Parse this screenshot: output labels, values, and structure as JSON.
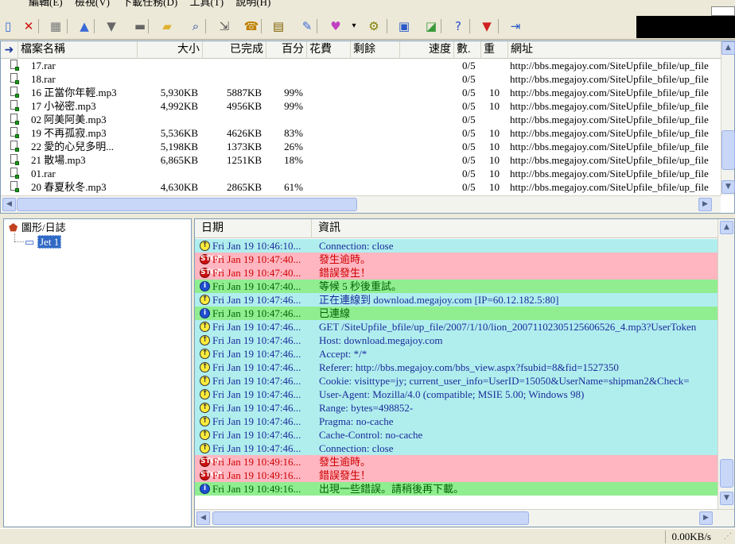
{
  "menu": [
    "編輯(E)",
    "檢視(V)",
    "下載任務(D)",
    "工具(T)",
    "說明(H)"
  ],
  "toolbar": {
    "icons": [
      {
        "name": "new-icon",
        "glyph": "▯",
        "color": "#3a6ad8"
      },
      {
        "name": "delete-icon",
        "glyph": "✕",
        "color": "#d01010"
      },
      {
        "name": "properties-icon",
        "glyph": "▦",
        "color": "#777777"
      },
      {
        "name": "move-up-icon",
        "glyph": "▲",
        "color": "#3a6ad8"
      },
      {
        "name": "move-down-icon",
        "glyph": "▼",
        "color": "#666666"
      },
      {
        "name": "stop-icon",
        "glyph": "▬",
        "color": "#666666"
      },
      {
        "name": "open-folder-icon",
        "glyph": "▰",
        "color": "#e0b030"
      },
      {
        "name": "find-icon",
        "glyph": "⌕",
        "color": "#1a3a9a"
      },
      {
        "name": "find-next-icon",
        "glyph": "⇲",
        "color": "#555555"
      },
      {
        "name": "dial-icon",
        "glyph": "☎",
        "color": "#c08000"
      },
      {
        "name": "schedule-icon",
        "glyph": "▤",
        "color": "#806000"
      },
      {
        "name": "edit-icon",
        "glyph": "✎",
        "color": "#3a6ad8"
      },
      {
        "name": "speed-icon",
        "glyph": "♥",
        "color": "#c040c0"
      },
      {
        "name": "dropdown-icon",
        "glyph": "▾",
        "color": "#000000"
      },
      {
        "name": "options-icon",
        "glyph": "⚙",
        "color": "#808000"
      },
      {
        "name": "site-manager-icon",
        "glyph": "▣",
        "color": "#2a5ac8"
      },
      {
        "name": "batch-icon",
        "glyph": "◪",
        "color": "#3a9a3a"
      },
      {
        "name": "help-icon",
        "glyph": "?",
        "color": "#2a4ac8"
      },
      {
        "name": "skin-icon",
        "glyph": "▼",
        "color": "#d02020"
      },
      {
        "name": "exit-icon",
        "glyph": "⇥",
        "color": "#2a5ac8"
      }
    ]
  },
  "filelist": {
    "columns": [
      "檔案名稱",
      "大小",
      "已完成",
      "百分",
      "花費",
      "剩餘",
      "速度",
      "數.",
      "重",
      "網址"
    ],
    "rows": [
      {
        "name": "17.rar",
        "size": "",
        "done": "",
        "pct": "",
        "cost": "",
        "left": "",
        "speed": "",
        "count": "0/5",
        "retry": "",
        "url": "http://bbs.megajoy.com/SiteUpfile_bfile/up_file"
      },
      {
        "name": "18.rar",
        "size": "",
        "done": "",
        "pct": "",
        "cost": "",
        "left": "",
        "speed": "",
        "count": "0/5",
        "retry": "",
        "url": "http://bbs.megajoy.com/SiteUpfile_bfile/up_file"
      },
      {
        "name": "16 正當你年輕.mp3",
        "size": "5,930KB",
        "done": "5887KB",
        "pct": "99%",
        "cost": "",
        "left": "",
        "speed": "",
        "count": "0/5",
        "retry": "10",
        "url": "http://bbs.megajoy.com/SiteUpfile_bfile/up_file"
      },
      {
        "name": "17 小祕密.mp3",
        "size": "4,992KB",
        "done": "4956KB",
        "pct": "99%",
        "cost": "",
        "left": "",
        "speed": "",
        "count": "0/5",
        "retry": "10",
        "url": "http://bbs.megajoy.com/SiteUpfile_bfile/up_file"
      },
      {
        "name": "02 阿美阿美.mp3",
        "size": "",
        "done": "",
        "pct": "",
        "cost": "",
        "left": "",
        "speed": "",
        "count": "0/5",
        "retry": "",
        "url": "http://bbs.megajoy.com/SiteUpfile_bfile/up_file"
      },
      {
        "name": "19 不再孤寂.mp3",
        "size": "5,536KB",
        "done": "4626KB",
        "pct": "83%",
        "cost": "",
        "left": "",
        "speed": "",
        "count": "0/5",
        "retry": "10",
        "url": "http://bbs.megajoy.com/SiteUpfile_bfile/up_file"
      },
      {
        "name": "22 愛的心兒多明...",
        "size": "5,198KB",
        "done": "1373KB",
        "pct": "26%",
        "cost": "",
        "left": "",
        "speed": "",
        "count": "0/5",
        "retry": "10",
        "url": "http://bbs.megajoy.com/SiteUpfile_bfile/up_file"
      },
      {
        "name": "21 散場.mp3",
        "size": "6,865KB",
        "done": "1251KB",
        "pct": "18%",
        "cost": "",
        "left": "",
        "speed": "",
        "count": "0/5",
        "retry": "10",
        "url": "http://bbs.megajoy.com/SiteUpfile_bfile/up_file"
      },
      {
        "name": "01.rar",
        "size": "",
        "done": "",
        "pct": "",
        "cost": "",
        "left": "",
        "speed": "",
        "count": "0/5",
        "retry": "10",
        "url": "http://bbs.megajoy.com/SiteUpfile_bfile/up_file"
      },
      {
        "name": "20 春夏秋冬.mp3",
        "size": "4,630KB",
        "done": "2865KB",
        "pct": "61%",
        "cost": "",
        "left": "",
        "speed": "",
        "count": "0/5",
        "retry": "10",
        "url": "http://bbs.megajoy.com/SiteUpfile_bfile/up_file"
      }
    ]
  },
  "tree": {
    "root": "圖形/日誌",
    "child": "Jet 1"
  },
  "log": {
    "columns": [
      "日期",
      "資訊"
    ],
    "rows": [
      {
        "type": "info",
        "date": "Fri Jan 19 10:46:10...",
        "msg": "Connection: close"
      },
      {
        "type": "error",
        "date": "Fri Jan 19 10:47:40...",
        "msg": "發生逾時。"
      },
      {
        "type": "error",
        "date": "Fri Jan 19 10:47:40...",
        "msg": "錯誤發生！"
      },
      {
        "type": "notice",
        "date": "Fri Jan 19 10:47:40...",
        "msg": "等候 5 秒後重試。"
      },
      {
        "type": "info",
        "date": "Fri Jan 19 10:47:46...",
        "msg": "正在連線到 download.megajoy.com [IP=60.12.182.5:80]"
      },
      {
        "type": "notice",
        "date": "Fri Jan 19 10:47:46...",
        "msg": "已連線"
      },
      {
        "type": "info",
        "date": "Fri Jan 19 10:47:46...",
        "msg": "GET /SiteUpfile_bfile/up_file/2007/1/10/lion_20071102305125606526_4.mp3?UserToken"
      },
      {
        "type": "info",
        "date": "Fri Jan 19 10:47:46...",
        "msg": "Host: download.megajoy.com"
      },
      {
        "type": "info",
        "date": "Fri Jan 19 10:47:46...",
        "msg": "Accept: */*"
      },
      {
        "type": "info",
        "date": "Fri Jan 19 10:47:46...",
        "msg": "Referer: http://bbs.megajoy.com/bbs_view.aspx?fsubid=8&fid=1527350"
      },
      {
        "type": "info",
        "date": "Fri Jan 19 10:47:46...",
        "msg": "Cookie: visittype=jy; current_user_info=UserID=15050&UserName=shipman2&Check="
      },
      {
        "type": "info",
        "date": "Fri Jan 19 10:47:46...",
        "msg": "User-Agent: Mozilla/4.0 (compatible; MSIE 5.00; Windows 98)"
      },
      {
        "type": "info",
        "date": "Fri Jan 19 10:47:46...",
        "msg": "Range: bytes=498852-"
      },
      {
        "type": "info",
        "date": "Fri Jan 19 10:47:46...",
        "msg": "Pragma: no-cache"
      },
      {
        "type": "info",
        "date": "Fri Jan 19 10:47:46...",
        "msg": "Cache-Control: no-cache"
      },
      {
        "type": "info",
        "date": "Fri Jan 19 10:47:46...",
        "msg": "Connection: close"
      },
      {
        "type": "error",
        "date": "Fri Jan 19 10:49:16...",
        "msg": "發生逾時。"
      },
      {
        "type": "error",
        "date": "Fri Jan 19 10:49:16...",
        "msg": "錯誤發生！"
      },
      {
        "type": "notice",
        "date": "Fri Jan 19 10:49:16...",
        "msg": "出現一些錯誤。請稍後再下載。"
      }
    ]
  },
  "status": {
    "speed": "0.00KB/s"
  },
  "colors": {
    "info_row": "#B0EEEE",
    "error_row": "#FFB6C1",
    "notice_row": "#90EE90",
    "selection": "#316AC5"
  }
}
